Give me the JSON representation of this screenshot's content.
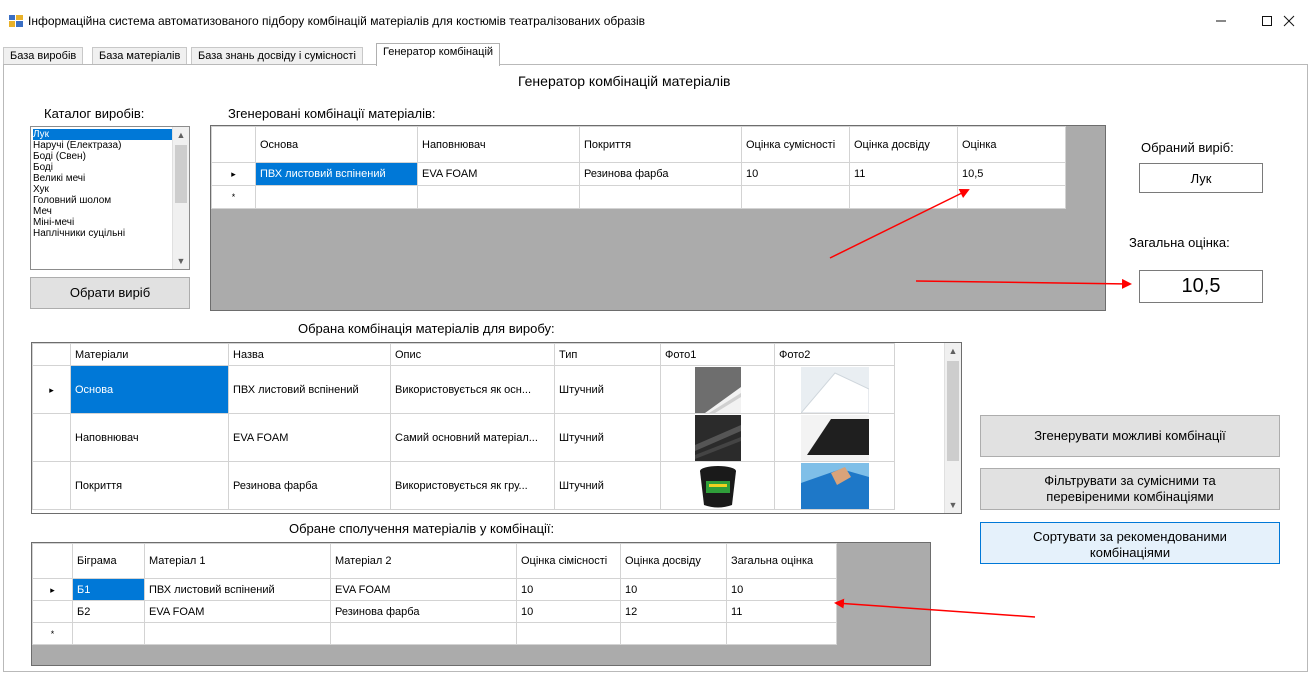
{
  "window": {
    "title": "Інформаційна система автоматизованого підбору комбінацій матеріалів для костюмів театралізованих образів",
    "minimize_icon": "minimize-icon",
    "maximize_icon": "maximize-icon",
    "close_icon": "close-icon"
  },
  "tabs": [
    {
      "label": "База виробів"
    },
    {
      "label": "База матеріалів"
    },
    {
      "label": "База знань досвіду і сумісності"
    },
    {
      "label": "Генератор комбінацій"
    }
  ],
  "page_title": "Генератор комбінацій матеріалів",
  "catalog": {
    "label": "Каталог виробів:",
    "items": [
      "Лук",
      "Наручі (Електраза)",
      "Боді (Свен)",
      "Боді",
      "Великі мечі",
      "Хук",
      "Головний шолом",
      "Меч",
      "Міні-мечі",
      "Наплічники суцільні"
    ],
    "selected_index": 0,
    "select_button": "Обрати виріб"
  },
  "generated": {
    "label": "Згенеровані комбінації матеріалів:",
    "columns": [
      "Основа",
      "Наповнювач",
      "Покриття",
      "Оцінка сумісності",
      "Оцінка досвіду",
      "Оцінка"
    ],
    "rows": [
      [
        "ПВХ листовий вспінений",
        "EVA FOAM",
        "Резинова фарба",
        "10",
        "11",
        "10,5"
      ]
    ],
    "new_row_marker": "*",
    "current_row_marker": "▸"
  },
  "selected_item": {
    "label": "Обраний виріб:",
    "value": "Лук"
  },
  "total_score": {
    "label": "Загальна оцінка:",
    "value": "10,5"
  },
  "combo": {
    "label": "Обрана комбінація матеріалів для виробу:",
    "columns": [
      "Матеріали",
      "Назва",
      "Опис",
      "Тип",
      "Фото1",
      "Фото2"
    ],
    "rows": [
      [
        "Основа",
        "ПВХ листовий вспінений",
        "Використовується як осн...",
        "Штучний"
      ],
      [
        "Наповнювач",
        "EVA FOAM",
        "Самий основний матеріал...",
        "Штучний"
      ],
      [
        "Покриття",
        "Резинова фарба",
        "Використовується як гру...",
        "Штучний"
      ]
    ]
  },
  "buttons": {
    "generate": "Згенерувати можливі комбінації",
    "filter": "Фільтрувати за сумісними та перевіреними комбінаціями",
    "sort": "Сортувати за рекомендованими комбінаціями"
  },
  "pairs": {
    "label": "Обране сполучення матеріалів у комбінації:",
    "columns": [
      "Біграма",
      "Матеріал 1",
      "Матеріал 2",
      "Оцінка сімісності",
      "Оцінка досвіду",
      "Загальна оцінка"
    ],
    "rows": [
      [
        "Б1",
        "ПВХ листовий вспінений",
        "EVA FOAM",
        "10",
        "10",
        "10"
      ],
      [
        "Б2",
        "EVA FOAM",
        "Резинова фарба",
        "10",
        "12",
        "11"
      ]
    ]
  },
  "colors": {
    "selection": "#0078d7",
    "annotation_arrow": "#ff0000",
    "grid_background": "#ababab"
  }
}
